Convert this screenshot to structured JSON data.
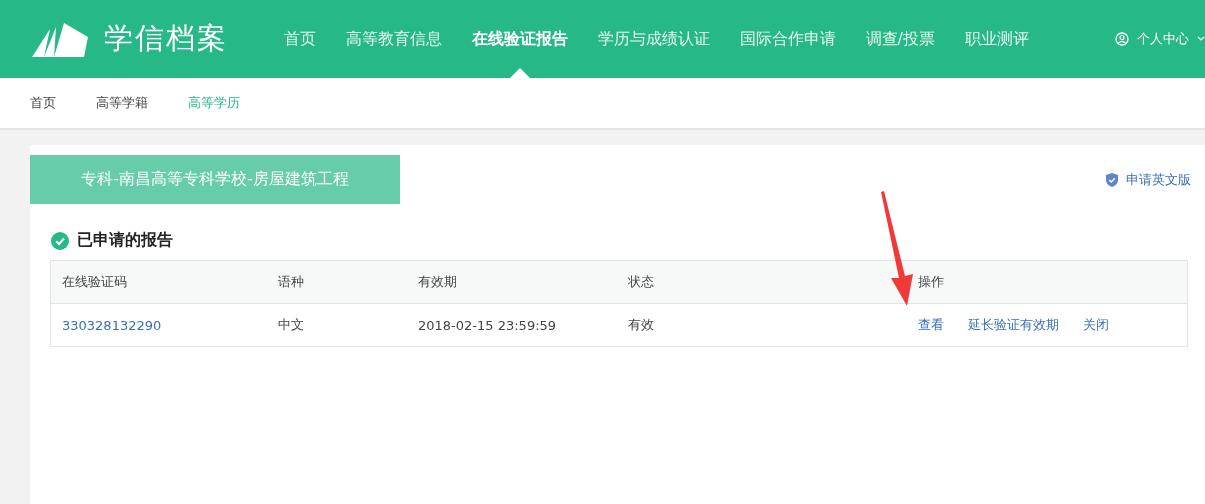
{
  "header": {
    "logo": "学信档案",
    "nav": [
      {
        "label": "首页",
        "selected": false
      },
      {
        "label": "高等教育信息",
        "selected": false
      },
      {
        "label": "在线验证报告",
        "selected": true
      },
      {
        "label": "学历与成绩认证",
        "selected": false
      },
      {
        "label": "国际合作申请",
        "selected": false
      },
      {
        "label": "调查/投票",
        "selected": false
      },
      {
        "label": "职业测评",
        "selected": false
      }
    ],
    "user_menu": "个人中心"
  },
  "breadcrumb": [
    {
      "label": "首页",
      "selected": false
    },
    {
      "label": "高等学籍",
      "selected": false
    },
    {
      "label": "高等学历",
      "selected": true
    }
  ],
  "record_tab": "专科-南昌高等专科学校-房屋建筑工程",
  "english_link": "申请英文版",
  "section_title": "已申请的报告",
  "table": {
    "columns": [
      "在线验证码",
      "语种",
      "有效期",
      "状态",
      "操作"
    ],
    "rows": [
      {
        "code": "330328132290",
        "language": "中文",
        "expiry": "2018-02-15 23:59:59",
        "status": "有效",
        "actions": [
          "查看",
          "延长验证有效期",
          "关闭"
        ]
      }
    ]
  }
}
